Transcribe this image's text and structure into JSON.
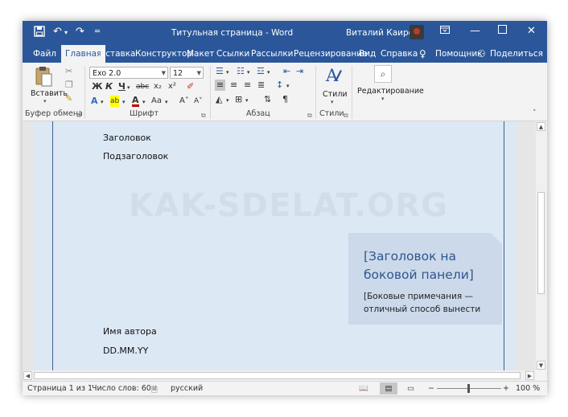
{
  "title_bar": {
    "document_title": "Титульная страница - Word",
    "user_name": "Виталий Каиров",
    "icons": [
      "save-icon",
      "undo-icon",
      "redo-icon",
      "customize-icon",
      "ribbon-display-icon",
      "minimize-icon",
      "maximize-icon",
      "close-icon"
    ]
  },
  "tabs": [
    "Файл",
    "Главная",
    "Вставка",
    "Конструктор",
    "Макет",
    "Ссылки",
    "Рассылки",
    "Рецензирование",
    "Вид",
    "Справка"
  ],
  "active_tab": "Главная",
  "help_search": "Помощник",
  "share": "Поделиться",
  "ribbon": {
    "clipboard": {
      "paste_label": "Вставить",
      "group_label": "Буфер обмена"
    },
    "font": {
      "font_name": "Exo 2.0",
      "font_size": "12",
      "bold": "Ж",
      "italic": "К",
      "underline": "Ч",
      "strike": "abc",
      "subscript": "x₂",
      "superscript": "x²",
      "case": "Aa",
      "grow": "A˄",
      "shrink": "A˅",
      "group_label": "Шрифт"
    },
    "paragraph": {
      "group_label": "Абзац",
      "pilcrow": "¶"
    },
    "styles": {
      "label": "Стили",
      "group_label": "Стили"
    },
    "editing": {
      "label": "Редактирование"
    }
  },
  "document": {
    "watermark": "KAK-SDELAT.ORG",
    "heading": "Заголовок",
    "subheading": "Подзаголовок",
    "sidebar_title": "[Заголовок на боковой панели]",
    "sidebar_note": "[Боковые примечания — отличный способ вынести",
    "author": "Имя автора",
    "date": "DD.MM.YY"
  },
  "status_bar": {
    "page": "Страница 1 из 1",
    "words": "Число слов: 60",
    "language": "русский",
    "zoom_minus": "−",
    "zoom_plus": "+",
    "zoom": "100 %",
    "zoom_level_percent": 100
  }
}
